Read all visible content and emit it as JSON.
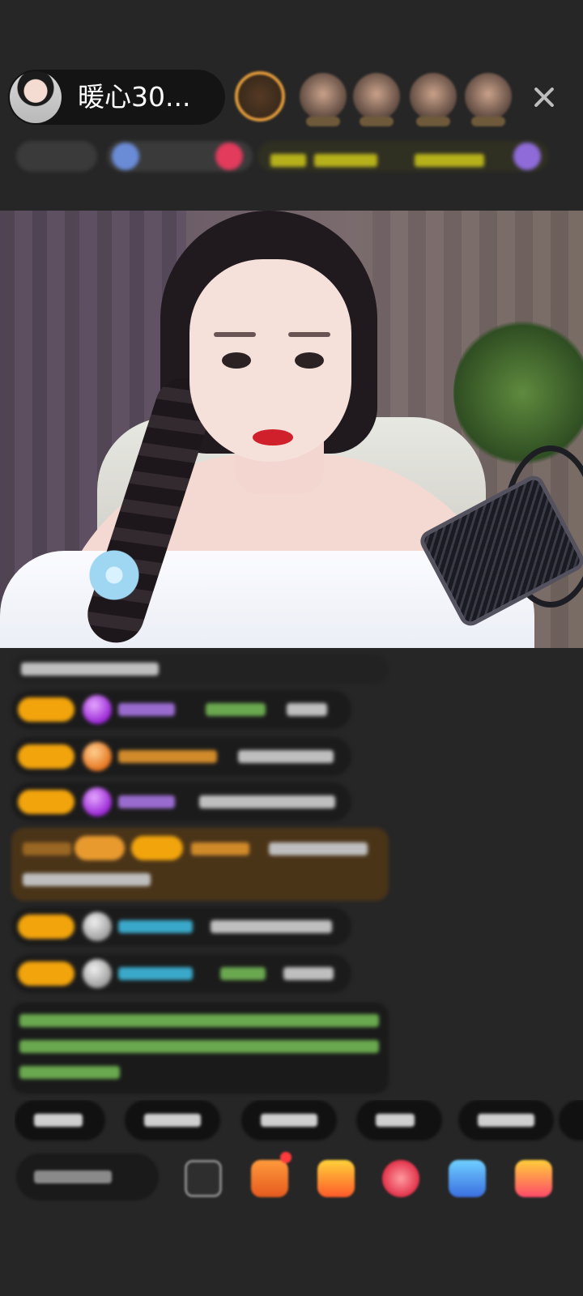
{
  "header": {
    "host_name": "暖心30...",
    "close_icon": "close-icon",
    "viewer_avatars": [
      "top-viewer-1",
      "viewer-2",
      "viewer-3",
      "viewer-4",
      "viewer-5"
    ]
  },
  "colors": {
    "background": "#262626",
    "level_badge": "#f2a40c",
    "highlight_message": "#4a3418"
  },
  "bottom_bar": {
    "icons": [
      "more-icon",
      "gift-box-icon",
      "treasure-icon",
      "heart-icon",
      "game-icon",
      "red-packet-icon"
    ]
  }
}
